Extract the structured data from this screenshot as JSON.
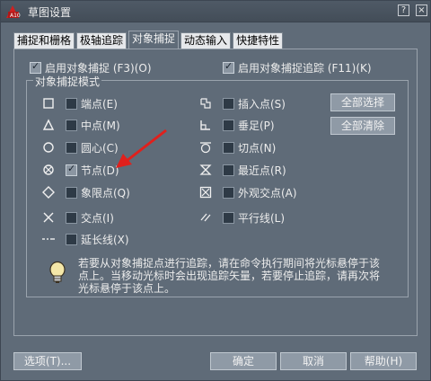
{
  "window": {
    "title": "草图设置",
    "app_badge": "A10",
    "help_glyph": "?",
    "close_glyph": "×"
  },
  "tabs": [
    {
      "label": "捕捉和栅格",
      "active": false
    },
    {
      "label": "极轴追踪",
      "active": false
    },
    {
      "label": "对象捕捉",
      "active": true
    },
    {
      "label": "动态输入",
      "active": false
    },
    {
      "label": "快捷特性",
      "active": false
    }
  ],
  "options": {
    "osnap_on": {
      "label": "启用对象捕捉 (F3)(O)",
      "checked": true
    },
    "otrack_on": {
      "label": "启用对象捕捉追踪 (F11)(K)",
      "checked": true
    }
  },
  "group": {
    "title": "对象捕捉模式"
  },
  "snap_left": [
    {
      "label": "端点(E)",
      "icon": "square-marker-icon",
      "checked": false
    },
    {
      "label": "中点(M)",
      "icon": "triangle-marker-icon",
      "checked": false
    },
    {
      "label": "圆心(C)",
      "icon": "circle-marker-icon",
      "checked": false
    },
    {
      "label": "节点(D)",
      "icon": "node-marker-icon",
      "checked": true
    },
    {
      "label": "象限点(Q)",
      "icon": "diamond-marker-icon",
      "checked": false
    },
    {
      "label": "交点(I)",
      "icon": "cross-marker-icon",
      "checked": false
    },
    {
      "label": "延长线(X)",
      "icon": "extension-marker-icon",
      "checked": false
    }
  ],
  "snap_right": [
    {
      "label": "插入点(S)",
      "icon": "insert-marker-icon",
      "checked": false
    },
    {
      "label": "垂足(P)",
      "icon": "perpendicular-marker-icon",
      "checked": false
    },
    {
      "label": "切点(N)",
      "icon": "tangent-marker-icon",
      "checked": false
    },
    {
      "label": "最近点(R)",
      "icon": "nearest-marker-icon",
      "checked": false
    },
    {
      "label": "外观交点(A)",
      "icon": "apparent-intersection-marker-icon",
      "checked": false
    },
    {
      "label": "平行线(L)",
      "icon": "parallel-marker-icon",
      "checked": false
    }
  ],
  "buttons": {
    "select_all": "全部选择",
    "clear_all": "全部清除",
    "options": "选项(T)...",
    "ok": "确定",
    "cancel": "取消",
    "help": "帮助(H)"
  },
  "hint": {
    "text": "若要从对象捕捉点进行追踪，请在命令执行期间将光标悬停于该点上。当移动光标时会出现追踪矢量，若要停止追踪，请再次将光标悬停于该点上。"
  },
  "colors": {
    "dialog_bg": "#5f6b78",
    "arrow": "#e0201c"
  }
}
